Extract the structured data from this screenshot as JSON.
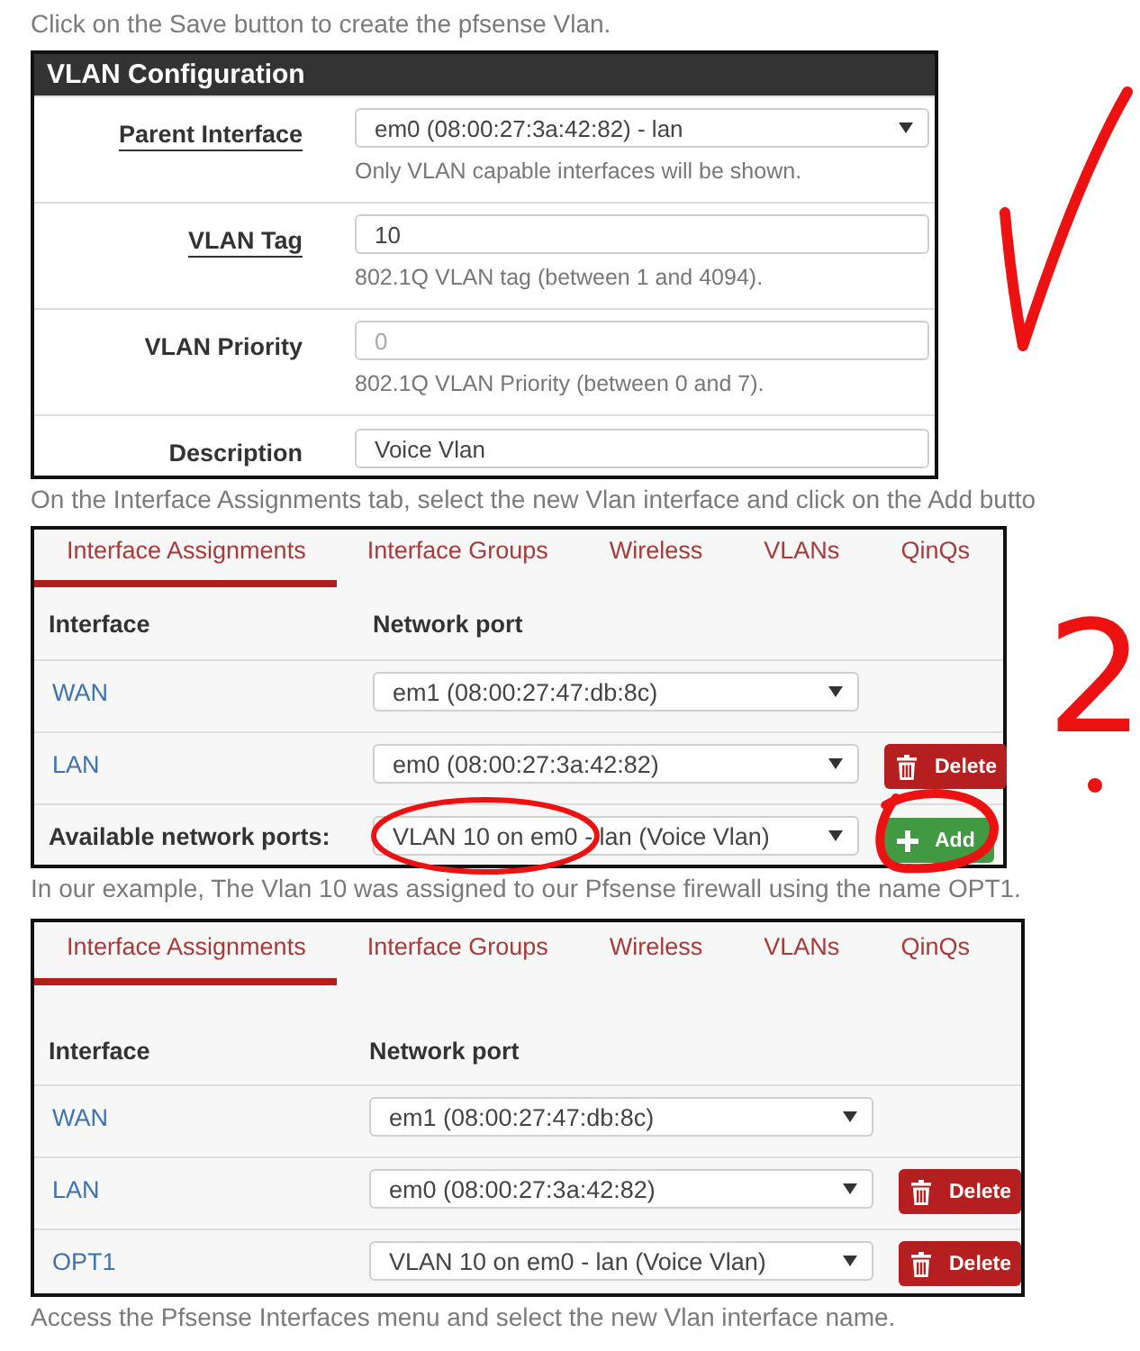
{
  "blocks": [
    {
      "kind": "caption",
      "text": "Click on the Save button to create the pfsense Vlan."
    },
    {
      "kind": "form",
      "title": "VLAN Configuration",
      "fields": [
        {
          "label": "Parent Interface",
          "required": true,
          "kind": "select",
          "value": "em0 (08:00:27:3a:42:82) - lan",
          "hint": "Only VLAN capable interfaces will be shown."
        },
        {
          "label": "VLAN Tag",
          "required": true,
          "kind": "input",
          "value": "10",
          "hint": "802.1Q VLAN tag (between 1 and 4094)."
        },
        {
          "label": "VLAN Priority",
          "required": false,
          "kind": "input",
          "placeholder": "0",
          "hint": "802.1Q VLAN Priority (between 0 and 7)."
        },
        {
          "label": "Description",
          "required": false,
          "kind": "input",
          "value": "Voice Vlan"
        }
      ],
      "annotation": {
        "kind": "check"
      }
    },
    {
      "kind": "caption",
      "text": "On the Interface Assignments tab, select the new Vlan interface and click on the Add butto"
    },
    {
      "kind": "assignments",
      "tabs": [
        {
          "label": "Interface Assignments",
          "selected": true
        },
        {
          "label": "Interface Groups",
          "selected": false
        },
        {
          "label": "Wireless",
          "selected": false
        },
        {
          "label": "VLANs",
          "selected": false
        },
        {
          "label": "QinQs",
          "selected": false
        }
      ],
      "columns": [
        "Interface",
        "Network port"
      ],
      "rows": [
        {
          "kind": "interface",
          "name": "WAN",
          "port": "em1 (08:00:27:47:db:8c)",
          "port_circled": false
        },
        {
          "kind": "interface",
          "name": "LAN",
          "port": "em0 (08:00:27:3a:42:82)",
          "port_circled": false,
          "button": {
            "kind": "delete",
            "label": "Delete",
            "circled": false
          }
        },
        {
          "kind": "available",
          "name": "Available network ports:",
          "port": "VLAN 10 on em0 - lan (Voice Vlan)",
          "port_circled": true,
          "button": {
            "kind": "add",
            "label": "Add",
            "circled": true
          }
        }
      ],
      "annotation": {
        "kind": "number",
        "text": "2"
      }
    },
    {
      "kind": "caption",
      "text": "In our example, The Vlan 10 was assigned to our Pfsense firewall using the name OPT1."
    },
    {
      "kind": "assignments",
      "tabs": [
        {
          "label": "Interface Assignments",
          "selected": true
        },
        {
          "label": "Interface Groups",
          "selected": false
        },
        {
          "label": "Wireless",
          "selected": false
        },
        {
          "label": "VLANs",
          "selected": false
        },
        {
          "label": "QinQs",
          "selected": false
        }
      ],
      "columns": [
        "Interface",
        "Network port"
      ],
      "rows": [
        {
          "kind": "interface",
          "name": "WAN",
          "port": "em1 (08:00:27:47:db:8c)",
          "port_circled": false
        },
        {
          "kind": "interface",
          "name": "LAN",
          "port": "em0 (08:00:27:3a:42:82)",
          "port_circled": false,
          "button": {
            "kind": "delete",
            "label": "Delete",
            "circled": false
          }
        },
        {
          "kind": "interface",
          "name": "OPT1",
          "port": "VLAN 10 on em0 - lan (Voice Vlan)",
          "port_circled": false,
          "button": {
            "kind": "delete",
            "label": "Delete",
            "circled": false
          }
        }
      ]
    },
    {
      "kind": "caption",
      "text": "Access the Pfsense Interfaces menu and select the new Vlan interface name."
    }
  ]
}
